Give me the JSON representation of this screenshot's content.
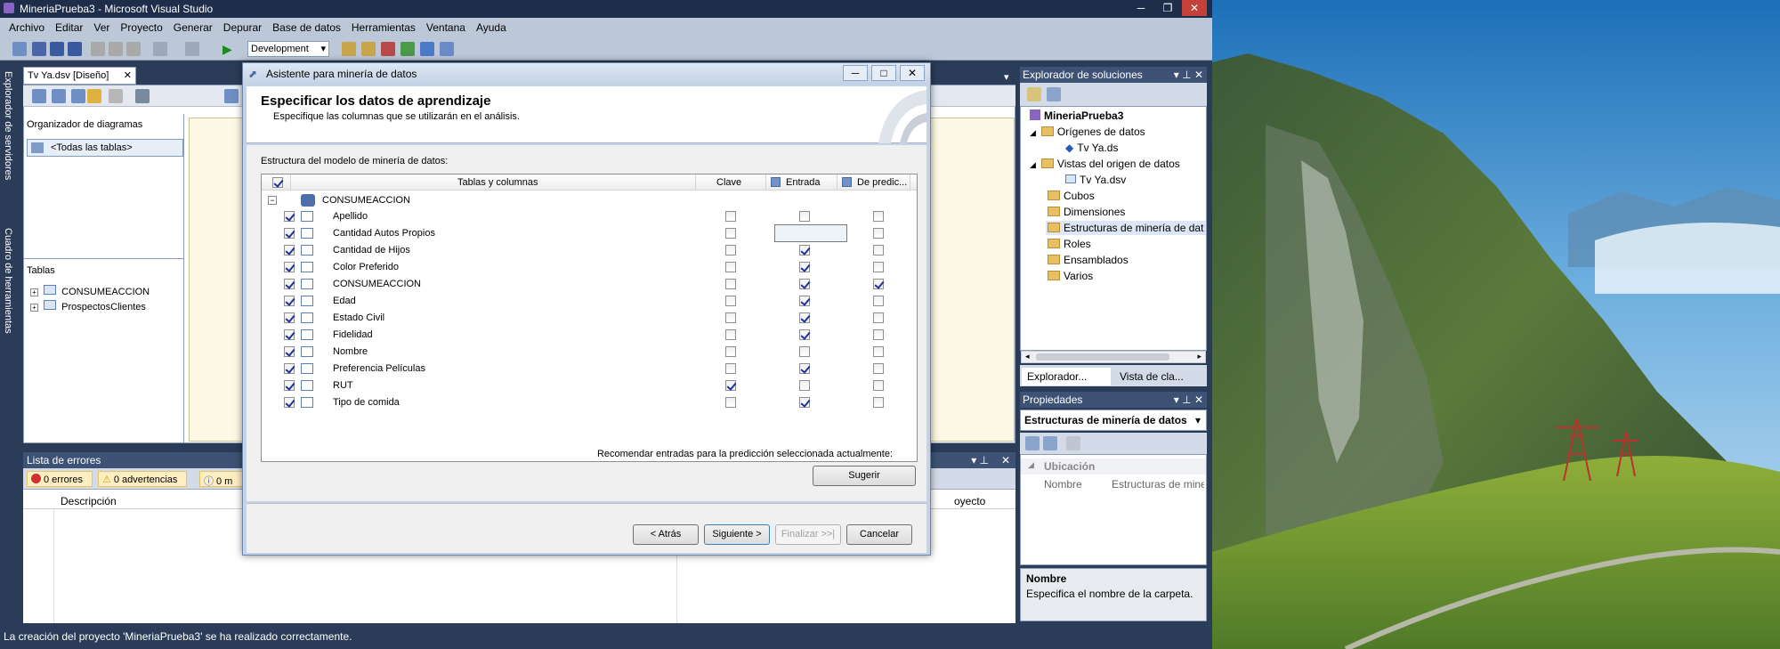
{
  "window": {
    "title": "MineriaPrueba3 - Microsoft Visual Studio",
    "controls": [
      "─",
      "❐",
      "✕"
    ]
  },
  "menu": [
    "Archivo",
    "Editar",
    "Ver",
    "Proyecto",
    "Generar",
    "Depurar",
    "Base de datos",
    "Herramientas",
    "Ventana",
    "Ayuda"
  ],
  "toolbar": {
    "configuration": "Development"
  },
  "side_tabs": {
    "server_explorer": "Explorador de servidores",
    "toolbox": "Cuadro de herramientas"
  },
  "document": {
    "tab_label": "Tv Ya.dsv [Diseño]",
    "diagram_organizer_label": "Organizador de diagramas",
    "diagram_item": "<Todas las tablas>",
    "tables_label": "Tablas",
    "tables": [
      "CONSUMEACCION",
      "ProspectosClientes"
    ]
  },
  "error_list": {
    "title": "Lista de errores",
    "errors": "0 errores",
    "warnings": "0 advertencias",
    "messages": "0 m",
    "col_description": "Descripción",
    "col_project": "oyecto"
  },
  "status_bar": {
    "text": "La creación del proyecto 'MineriaPrueba3' se ha realizado correctamente."
  },
  "solution_explorer": {
    "title": "Explorador de soluciones",
    "tree": [
      {
        "label": "MineriaPrueba3"
      },
      {
        "label": "Orígenes de datos"
      },
      {
        "label": "Tv Ya.ds"
      },
      {
        "label": "Vistas del origen de datos"
      },
      {
        "label": "Tv Ya.dsv"
      },
      {
        "label": "Cubos"
      },
      {
        "label": "Dimensiones"
      },
      {
        "label": "Estructuras de minería de dat"
      },
      {
        "label": "Roles"
      },
      {
        "label": "Ensamblados"
      },
      {
        "label": "Varios"
      }
    ],
    "tab_explorer": "Explorador...",
    "tab_class_view": "Vista de cla..."
  },
  "properties": {
    "title": "Propiedades",
    "selected_object": "Estructuras de minería de datos",
    "category": "Ubicación",
    "prop_name": "Nombre",
    "prop_value": "Estructuras de mine",
    "desc_title": "Nombre",
    "desc_text": "Especifica el nombre de la carpeta."
  },
  "dialog": {
    "title": "Asistente para minería de datos",
    "heading": "Especificar los datos de aprendizaje",
    "subheading": "Especifique las columnas que se utilizarán en el análisis.",
    "structure_label": "Estructura del modelo de minería de datos:",
    "columns": {
      "tables_columns": "Tablas y columnas",
      "key": "Clave",
      "input": "Entrada",
      "predict": "De predic..."
    },
    "table_name": "CONSUMEACCION",
    "rows": [
      {
        "name": "Apellido",
        "key": false,
        "input": false,
        "predict": false
      },
      {
        "name": "Cantidad Autos Propios",
        "key": false,
        "input": true,
        "predict": false
      },
      {
        "name": "Cantidad de Hijos",
        "key": false,
        "input": true,
        "predict": false
      },
      {
        "name": "Color Preferido",
        "key": false,
        "input": true,
        "predict": false
      },
      {
        "name": "CONSUMEACCION",
        "key": false,
        "input": true,
        "predict": true
      },
      {
        "name": "Edad",
        "key": false,
        "input": true,
        "predict": false
      },
      {
        "name": "Estado Civil",
        "key": false,
        "input": true,
        "predict": false
      },
      {
        "name": "Fidelidad",
        "key": false,
        "input": true,
        "predict": false
      },
      {
        "name": "Nombre",
        "key": false,
        "input": false,
        "predict": false
      },
      {
        "name": "Preferencia Películas",
        "key": false,
        "input": true,
        "predict": false
      },
      {
        "name": "RUT",
        "key": true,
        "input": false,
        "predict": false
      },
      {
        "name": "Tipo de comida",
        "key": false,
        "input": true,
        "predict": false
      }
    ],
    "recommend_label": "Recomendar entradas para la predicción seleccionada actualmente:",
    "suggest_button": "Sugerir",
    "back_button": "< Atrás",
    "next_button": "Siguiente >",
    "finish_button": "Finalizar >>|",
    "cancel_button": "Cancelar"
  }
}
